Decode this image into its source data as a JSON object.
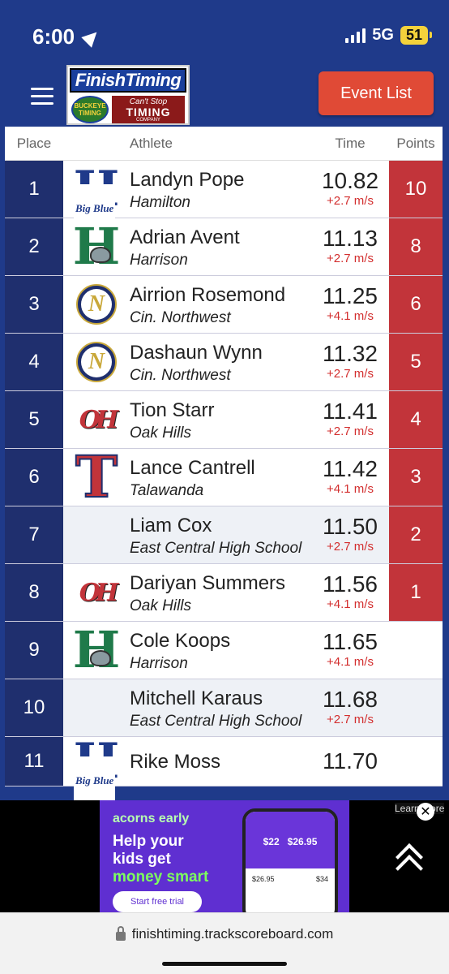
{
  "status_bar": {
    "time": "6:00",
    "network": "5G",
    "battery": "51"
  },
  "header": {
    "logo_title": "FinishTiming",
    "logo_left": "BUCKEYE TIMING",
    "logo_right_line1": "Can't Stop",
    "logo_right_line2": "TIMING",
    "logo_right_line3": "COMPANY",
    "event_list_label": "Event List"
  },
  "table": {
    "columns": {
      "place": "Place",
      "athlete": "Athlete",
      "time": "Time",
      "points": "Points"
    },
    "rows": [
      {
        "place": "1",
        "name": "Landyn Pope",
        "school": "Hamilton",
        "time": "10.82",
        "wind": "+2.7 m/s",
        "points": "10",
        "logo": "hamilton-big-blue-logo"
      },
      {
        "place": "2",
        "name": "Adrian Avent",
        "school": "Harrison",
        "time": "11.13",
        "wind": "+2.7 m/s",
        "points": "8",
        "logo": "harrison-wildcat-logo"
      },
      {
        "place": "3",
        "name": "Airrion Rosemond",
        "school": "Cin. Northwest",
        "time": "11.25",
        "wind": "+4.1 m/s",
        "points": "6",
        "logo": "northwest-n-logo"
      },
      {
        "place": "4",
        "name": "Dashaun Wynn",
        "school": "Cin. Northwest",
        "time": "11.32",
        "wind": "+2.7 m/s",
        "points": "5",
        "logo": "northwest-n-logo"
      },
      {
        "place": "5",
        "name": "Tion Starr",
        "school": "Oak Hills",
        "time": "11.41",
        "wind": "+2.7 m/s",
        "points": "4",
        "logo": "oak-hills-logo"
      },
      {
        "place": "6",
        "name": "Lance Cantrell",
        "school": "Talawanda",
        "time": "11.42",
        "wind": "+4.1 m/s",
        "points": "3",
        "logo": "talawanda-t-logo"
      },
      {
        "place": "7",
        "name": "Liam Cox",
        "school": "East Central High School",
        "time": "11.50",
        "wind": "+2.7 m/s",
        "points": "2",
        "logo": ""
      },
      {
        "place": "8",
        "name": "Dariyan Summers",
        "school": "Oak Hills",
        "time": "11.56",
        "wind": "+4.1 m/s",
        "points": "1",
        "logo": "oak-hills-logo"
      },
      {
        "place": "9",
        "name": "Cole Koops",
        "school": "Harrison",
        "time": "11.65",
        "wind": "+4.1 m/s",
        "points": "",
        "logo": "harrison-wildcat-logo"
      },
      {
        "place": "10",
        "name": "Mitchell Karaus",
        "school": "East Central High School",
        "time": "11.68",
        "wind": "+2.7 m/s",
        "points": "",
        "logo": ""
      },
      {
        "place": "11",
        "name": "Rike Moss",
        "school": "",
        "time": "11.70",
        "wind": "",
        "points": "",
        "logo": "hamilton-big-blue-logo"
      }
    ]
  },
  "ad": {
    "brand": "acorns early",
    "headline_1": "Help your",
    "headline_2": "kids get",
    "headline_3": "money smart",
    "cta": "Start free trial",
    "phone_amount_1": "$22",
    "phone_amount_2": "$26.95",
    "phone_small_1": "$26.95",
    "phone_small_2": "$34",
    "learn_more": "Learn More"
  },
  "url_bar": {
    "url": "finishtiming.trackscoreboard.com"
  },
  "colors": {
    "navy": "#1f2f6e",
    "header_blue": "#1f3a8a",
    "points_red": "#c2343a",
    "wind_red": "#d32f2f",
    "button_red": "#e04a36"
  }
}
